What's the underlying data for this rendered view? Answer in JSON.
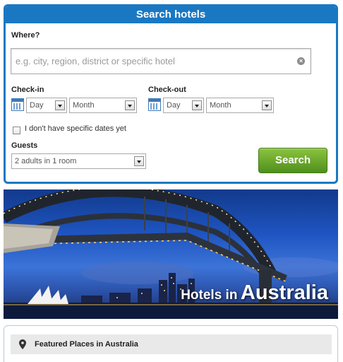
{
  "search": {
    "header": "Search hotels",
    "where_label": "Where?",
    "where_placeholder": "e.g. city, region, district or specific hotel",
    "clear_icon": "clear-icon",
    "checkin": {
      "label": "Check-in",
      "day": "Day",
      "month": "Month"
    },
    "checkout": {
      "label": "Check-out",
      "day": "Day",
      "month": "Month"
    },
    "no_dates_label": "I don't have specific dates yet",
    "guests_label": "Guests",
    "guests_value": "2 adults in 1 room",
    "button_label": "Search"
  },
  "banner": {
    "prefix": "Hotels in",
    "country": "Australia"
  },
  "featured": {
    "title": "Featured Places in Australia",
    "icon": "map-pin-icon"
  },
  "colors": {
    "accent": "#1a78c2",
    "search_button": "#6aa82c"
  }
}
